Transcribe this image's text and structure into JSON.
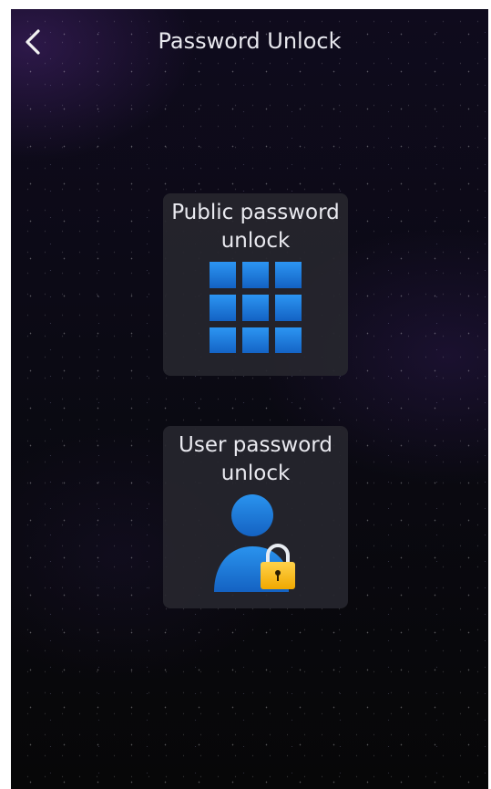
{
  "header": {
    "title": "Password Unlock",
    "back_icon": "chevron-left-icon"
  },
  "options": [
    {
      "label": "Public password unlock",
      "icon": "keypad-grid-icon",
      "icon_colors": [
        "#2c8ff0",
        "#1565c8"
      ]
    },
    {
      "label": "User password unlock",
      "icon": "user-lock-icon",
      "icon_colors": [
        "#1e88e5",
        "#f4b400"
      ]
    }
  ],
  "colors": {
    "background": "#0b0a14",
    "card": "#26262e",
    "text": "#eaeaf0"
  }
}
